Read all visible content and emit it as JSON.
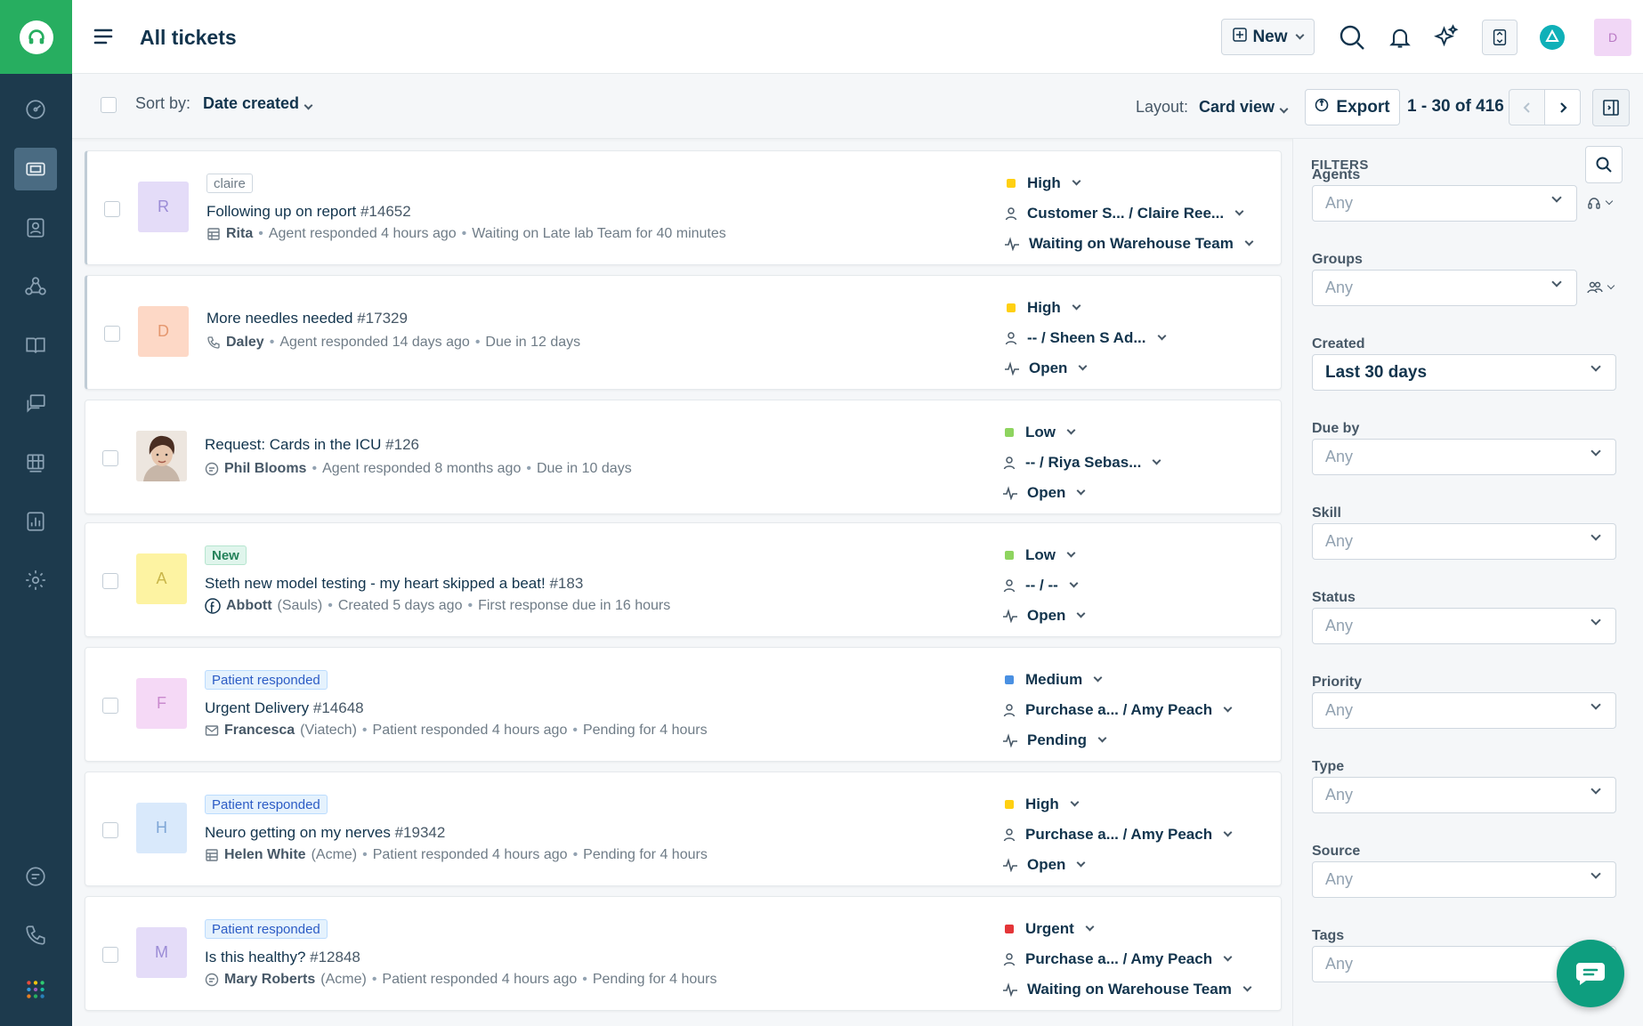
{
  "app": {
    "title": "All tickets",
    "new_label": "New",
    "avatar_initial": "D",
    "brand_color": "#27ae60",
    "rail_color": "#1d3a4d"
  },
  "rail": {
    "items": [
      {
        "icon": "dashboard-icon"
      },
      {
        "icon": "tickets-icon",
        "active": true
      },
      {
        "icon": "contacts-icon"
      },
      {
        "icon": "groups-icon"
      },
      {
        "icon": "knowledge-base-icon"
      },
      {
        "icon": "forums-icon"
      },
      {
        "icon": "service-icon"
      },
      {
        "icon": "reports-icon"
      },
      {
        "icon": "admin-gear-icon"
      },
      {
        "icon": "chat-icon"
      },
      {
        "icon": "phone-icon"
      },
      {
        "icon": "apps-grid-icon"
      }
    ]
  },
  "toolbar": {
    "sort_label": "Sort by:",
    "sort_value": "Date created",
    "layout_label": "Layout:",
    "layout_value": "Card view",
    "export_label": "Export",
    "pagination": "1 - 30 of 416"
  },
  "tickets": [
    {
      "avatar": "R",
      "avatar_bg": "#e4dcf8",
      "avatar_fg": "#9b8cd6",
      "tag": "claire",
      "tag_type": "grey",
      "subject": "Following up on report",
      "number": "#14652",
      "source_icon": "portal-icon",
      "requester": "Rita",
      "company": "",
      "detail1": "Agent responded 4 hours ago",
      "detail2": "Waiting on Late lab Team for 40 minutes",
      "priority": "High",
      "priority_color": "#ffd012",
      "assignee": "Customer S... / Claire Ree...",
      "status": "Waiting on Warehouse Team"
    },
    {
      "avatar": "D",
      "avatar_bg": "#fdd8c6",
      "avatar_fg": "#e59870",
      "tag": "",
      "tag_type": "",
      "subject": "More needles needed",
      "number": "#17329",
      "source_icon": "phone-icon",
      "requester": "Daley",
      "company": "",
      "detail1": "Agent responded 14 days ago",
      "detail2": "Due in 12 days",
      "priority": "High",
      "priority_color": "#ffd012",
      "assignee": "-- / Sheen S Ad...",
      "status": "Open"
    },
    {
      "avatar": "",
      "avatar_bg": "",
      "avatar_fg": "",
      "tag": "",
      "tag_type": "",
      "subject": "Request: Cards in the ICU",
      "number": "#126",
      "source_icon": "chat-icon",
      "requester": "Phil Blooms",
      "company": "",
      "detail1": "Agent responded 8 months ago",
      "detail2": "Due in 10 days",
      "priority": "Low",
      "priority_color": "#8ed45f",
      "assignee": "-- / Riya Sebas...",
      "status": "Open"
    },
    {
      "avatar": "A",
      "avatar_bg": "#fdf3a2",
      "avatar_fg": "#c9b64a",
      "tag": "New",
      "tag_type": "new",
      "subject": "Steth new model testing - my heart skipped a beat!",
      "number": "#183",
      "source_icon": "facebook-icon",
      "requester": "Abbott",
      "company": "(Sauls)",
      "detail1": "Created 5 days ago",
      "detail2": "First response due in 16 hours",
      "priority": "Low",
      "priority_color": "#8ed45f",
      "assignee": "-- / --",
      "status": "Open"
    },
    {
      "avatar": "F",
      "avatar_bg": "#f5d9f6",
      "avatar_fg": "#c98ace",
      "tag": "Patient responded",
      "tag_type": "resp",
      "subject": "Urgent Delivery",
      "number": "#14648",
      "source_icon": "email-icon",
      "requester": "Francesca",
      "company": "(Viatech)",
      "detail1": "Patient responded 4 hours ago",
      "detail2": "Pending for 4 hours",
      "priority": "Medium",
      "priority_color": "#4a90e2",
      "assignee": "Purchase a... / Amy Peach",
      "status": "Pending"
    },
    {
      "avatar": "H",
      "avatar_bg": "#d9e9fb",
      "avatar_fg": "#7fa6d6",
      "tag": "Patient responded",
      "tag_type": "resp",
      "subject": "Neuro getting on my nerves",
      "number": "#19342",
      "source_icon": "portal-icon",
      "requester": "Helen White",
      "company": "(Acme)",
      "detail1": "Patient responded 4 hours ago",
      "detail2": "Pending for 4 hours",
      "priority": "High",
      "priority_color": "#ffd012",
      "assignee": "Purchase a... / Amy Peach",
      "status": "Open"
    },
    {
      "avatar": "M",
      "avatar_bg": "#e4dcf8",
      "avatar_fg": "#9b8cd6",
      "tag": "Patient responded",
      "tag_type": "resp",
      "subject": "Is this healthy?",
      "number": "#12848",
      "source_icon": "chat-icon",
      "requester": "Mary Roberts",
      "company": "(Acme)",
      "detail1": "Patient responded 4 hours ago",
      "detail2": "Pending for 4 hours",
      "priority": "Urgent",
      "priority_color": "#e43538",
      "assignee": "Purchase a... / Amy Peach",
      "status": "Waiting on Warehouse Team"
    }
  ],
  "filters": {
    "title": "FILTERS",
    "fields": [
      {
        "label": "Agents",
        "value": "Any",
        "side_icon": "headset-icon"
      },
      {
        "label": "Groups",
        "value": "Any",
        "side_icon": "group-icon"
      },
      {
        "label": "Created",
        "value": "Last 30 days"
      },
      {
        "label": "Due by",
        "value": "Any"
      },
      {
        "label": "Skill",
        "value": "Any"
      },
      {
        "label": "Status",
        "value": "Any"
      },
      {
        "label": "Priority",
        "value": "Any"
      },
      {
        "label": "Type",
        "value": "Any"
      },
      {
        "label": "Source",
        "value": "Any"
      },
      {
        "label": "Tags",
        "value": "Any"
      }
    ]
  }
}
